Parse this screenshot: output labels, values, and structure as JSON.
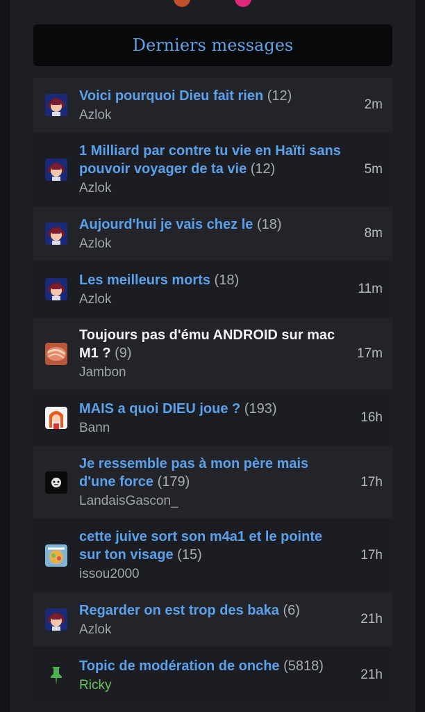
{
  "header": {
    "title": "Derniers messages"
  },
  "topics": [
    {
      "title": "Voici pourquoi Dieu fait rien",
      "count": "(12)",
      "author": "Azlok",
      "time": "2m",
      "avatar": "anime-avatar",
      "read": false
    },
    {
      "title": "1 Milliard par contre tu vie en Haïti sans pouvoir voyager de ta vie",
      "count": "(12)",
      "author": "Azlok",
      "time": "5m",
      "avatar": "anime-avatar",
      "read": false
    },
    {
      "title": "Aujourd'hui je vais chez le",
      "count": "(18)",
      "author": "Azlok",
      "time": "8m",
      "avatar": "anime-avatar",
      "read": false
    },
    {
      "title": "Les meilleurs morts",
      "count": "(18)",
      "author": "Azlok",
      "time": "11m",
      "avatar": "anime-avatar",
      "read": false
    },
    {
      "title": "Toujours pas d'ému ANDROID sur mac M1 ?",
      "count": "(9)",
      "author": "Jambon",
      "time": "17m",
      "avatar": "ham-avatar",
      "read": true
    },
    {
      "title": "MAIS a quoi DIEU joue ?",
      "count": "(193)",
      "author": "Bann",
      "time": "16h",
      "avatar": "redhead-avatar",
      "read": false
    },
    {
      "title": "Je ressemble pas à mon père mais d'une force",
      "count": "(179)",
      "author": "LandaisGascon_",
      "time": "17h",
      "avatar": "dark-avatar",
      "read": false
    },
    {
      "title": "cette juive sort son m4a1 et le pointe sur ton visage",
      "count": "(15)",
      "author": "issou2000",
      "time": "17h",
      "avatar": "colorful-avatar",
      "read": false
    },
    {
      "title": "Regarder on est trop des baka",
      "count": "(6)",
      "author": "Azlok",
      "time": "21h",
      "avatar": "anime-avatar",
      "read": false
    },
    {
      "title": "Topic de modération de onche",
      "count": "(5818)",
      "author": "Ricky",
      "time": "21h",
      "avatar": "pin-icon",
      "read": false,
      "moderator": true
    }
  ],
  "colors": {
    "link": "#5aa1ea",
    "moderator": "#6ac35a",
    "pin": "#4caf50"
  }
}
